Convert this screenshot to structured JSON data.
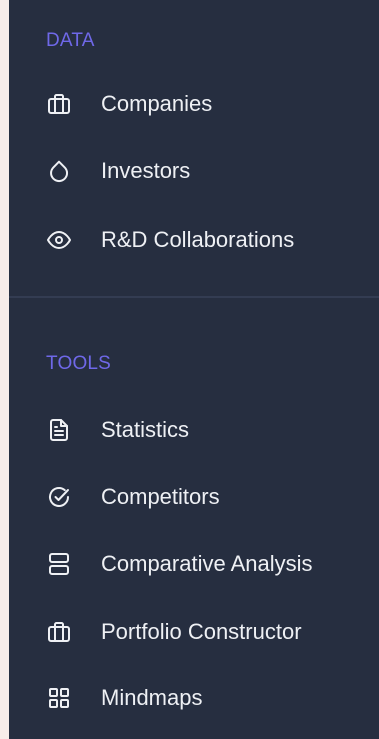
{
  "sections": [
    {
      "label": "DATA",
      "items": [
        {
          "label": "Companies",
          "icon": "briefcase-icon"
        },
        {
          "label": "Investors",
          "icon": "droplet-icon"
        },
        {
          "label": "R&D Collaborations",
          "icon": "eye-icon"
        }
      ]
    },
    {
      "label": "TOOLS",
      "items": [
        {
          "label": "Statistics",
          "icon": "file-text-icon"
        },
        {
          "label": "Competitors",
          "icon": "check-circle-icon"
        },
        {
          "label": "Comparative Analysis",
          "icon": "server-icon"
        },
        {
          "label": "Portfolio Constructor",
          "icon": "briefcase-icon"
        },
        {
          "label": "Mindmaps",
          "icon": "grid-icon"
        }
      ]
    }
  ],
  "colors": {
    "sidebar_bg": "#262e40",
    "section_label": "#6f68e8",
    "item_text": "#eef0f4"
  }
}
